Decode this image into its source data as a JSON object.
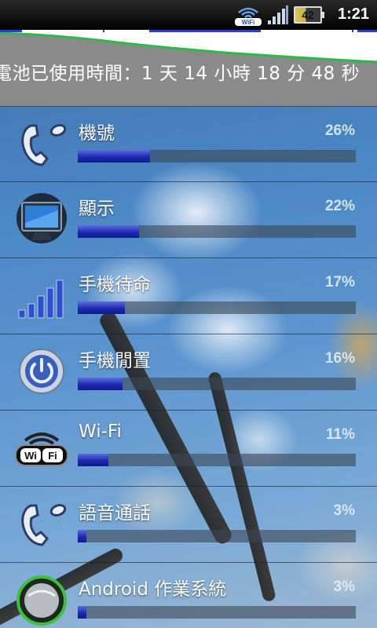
{
  "status_bar": {
    "time": "1:21",
    "battery_level": "42",
    "wifi_icon": "wifi-icon",
    "signal_icon": "signal-strength-icon",
    "battery_icon": "battery-icon"
  },
  "header": {
    "usage_time": "電池已使用時間：1 天 14 小時 18 分 48 秒"
  },
  "usage_items": [
    {
      "label": "機號",
      "percent": "26%",
      "fraction": 0.26,
      "icon": "phone-handset-icon"
    },
    {
      "label": "顯示",
      "percent": "22%",
      "fraction": 0.22,
      "icon": "monitor-icon"
    },
    {
      "label": "手機待命",
      "percent": "17%",
      "fraction": 0.17,
      "icon": "signal-bars-icon"
    },
    {
      "label": "手機閒置",
      "percent": "16%",
      "fraction": 0.16,
      "icon": "power-icon"
    },
    {
      "label": "Wi-Fi",
      "percent": "11%",
      "fraction": 0.11,
      "icon": "wifi-icon"
    },
    {
      "label": "語音通話",
      "percent": "3%",
      "fraction": 0.03,
      "icon": "phone-handset-icon"
    },
    {
      "label": "Android 作業系統",
      "percent": "3%",
      "fraction": 0.03,
      "icon": "android-os-icon"
    }
  ],
  "colors": {
    "bar_fill": "#1d2ab0",
    "graph_line": "#2db84a",
    "graph_track_marks": "#2a3bd6"
  }
}
